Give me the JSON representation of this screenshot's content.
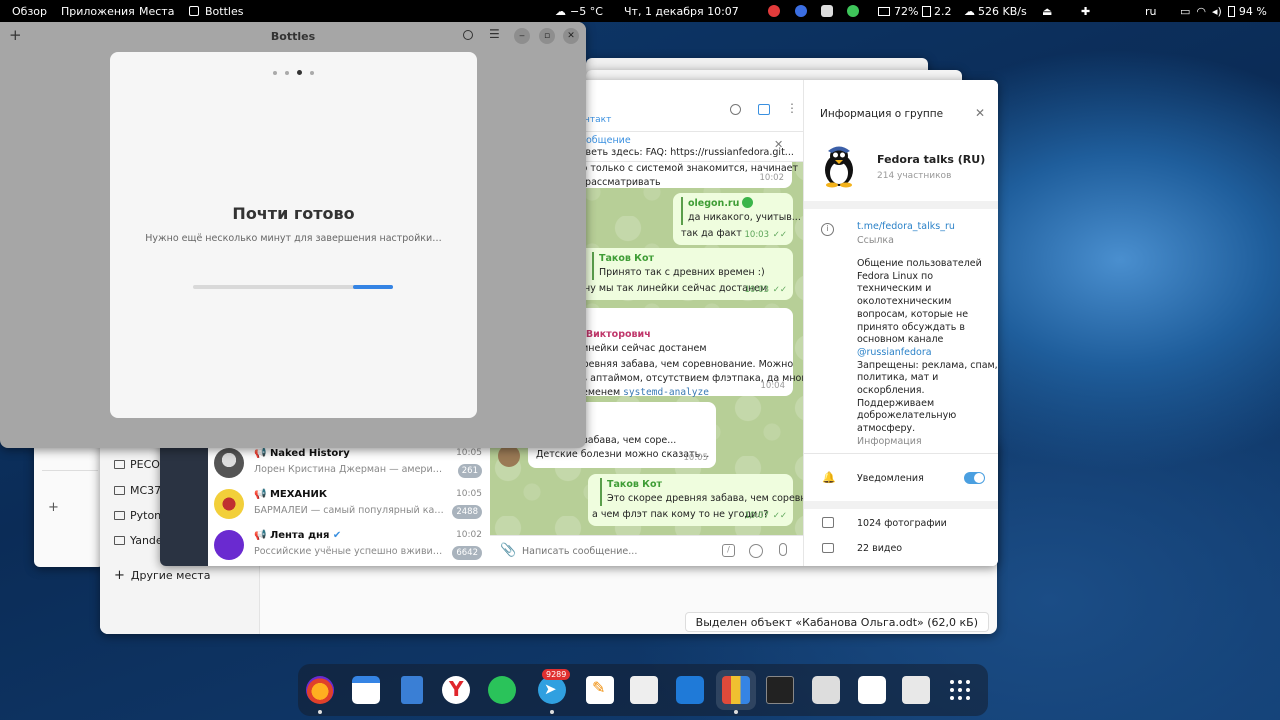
{
  "topbar": {
    "overview": "Обзор",
    "apps": "Приложения",
    "places": "Места",
    "active_app": "Bottles",
    "weather": "−5 °C",
    "datetime": "Чт, 1 декабря  10:07",
    "cpu": "72%",
    "load": "2.2",
    "net": "526 KB/s",
    "lang": "ru",
    "battery": "94 %"
  },
  "bottles": {
    "title": "Bottles",
    "dialog_title": "Почти готово",
    "dialog_subtitle": "Нужно ещё несколько минут для завершения настройки…",
    "progress": 0.2
  },
  "filemanager": {
    "items": [
      "PECO",
      "MC37",
      "Pyton",
      "Yandex"
    ],
    "other_places": "Другие места",
    "status": "Выделен объект «Кабанова Ольга.odt» (62,0 кБ)"
  },
  "telegram": {
    "header_status": "нтакт",
    "pin": {
      "title": "общение",
      "text": "тветь здесь: FAQ: https://russianfedora.git..."
    },
    "messages": [
      {
        "text1": "и, кто только с системой знакомится, начинает",
        "text2": "мять рассматривать",
        "time": "10:02"
      },
      {
        "quote_name": "olegon.ru",
        "quote_text": "да никакого, учитыв...",
        "text": "так да факт",
        "time": "10:03"
      },
      {
        "quote_name": "Таков Кот",
        "quote_text": "Принято так с древних времен :)",
        "text": "ну мы так линейки сейчас достанем",
        "time": "10:03"
      },
      {
        "name": "о Викторович",
        "text1": "линейки сейчас достанем",
        "text2": "древняя забава, чем соревнование. Можно",
        "text3": "ть аптаймом, отсутствием флэтпака, да много",
        "text4_pre": "ременем ",
        "text4_mono": "systemd-analyze",
        "time": "10:04"
      },
      {
        "text1": "древняя забава, чем соре...",
        "text2": "Детские болезни можно сказать...",
        "time": "10:05"
      },
      {
        "quote_name": "Таков Кот",
        "quote_text": "Это скорее древняя забава, чем соревно...",
        "text": "а чем флэт пак кому то не угодил?",
        "time": "10:07"
      }
    ],
    "input_placeholder": "Написать сообщение...",
    "chats": [
      {
        "name": "Naked History",
        "preview": "Лорен Кристина Джерман — американская ...",
        "time": "10:05",
        "badge": "261"
      },
      {
        "name": "МЕХАНИК",
        "preview": "БАРМАЛЕЙ — самый популярный канал о ...",
        "time": "10:05",
        "badge": "2488"
      },
      {
        "name": "Лента дня",
        "preview": "Российские учёные успешно вживили ...",
        "time": "10:02",
        "badge": "6642"
      }
    ],
    "info": {
      "header": "Информация о группе",
      "group_name": "Fedora talks (RU)",
      "members": "214 участников",
      "link": "t.me/fedora_talks_ru",
      "link_label": "Ссылка",
      "desc_lines": [
        "Общение пользователей",
        "Fedora Linux по",
        "техническим и",
        "околотехническим",
        "вопросам, которые не",
        "принято обсуждать в",
        "основном канале"
      ],
      "desc_link": "@russianfedora",
      "desc_lines2": [
        "Запрещены: реклама, спам,",
        "политика, мат и",
        "оскорбления.",
        "Поддерживаем",
        "доброжелательную",
        "атмосферу."
      ],
      "desc_label": "Информация",
      "notifications": "Уведомления",
      "photos": "1024 фотографии",
      "videos": "22 видео"
    }
  },
  "dock": {
    "telegram_badge": "9289"
  }
}
